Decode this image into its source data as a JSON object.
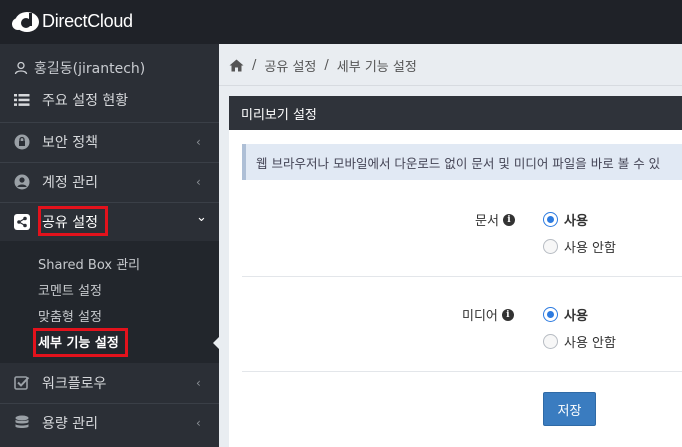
{
  "app": {
    "logo_text": "DirectCloud",
    "colors": {
      "topbar": "#1f2228",
      "sidebar": "#2b2f36",
      "accent": "#3a7cc0",
      "highlight": "#e3121c"
    }
  },
  "sidebar": {
    "user": {
      "icon": "user-icon",
      "name": "홍길동(jirantech)"
    },
    "items": [
      {
        "icon": "list-icon",
        "label": "주요 설정 현황",
        "chevron": ""
      },
      {
        "icon": "lock-icon",
        "label": "보안 정책",
        "chevron": "‹"
      },
      {
        "icon": "account-icon",
        "label": "계정 관리",
        "chevron": "‹"
      },
      {
        "icon": "share-icon",
        "label": "공유 설정",
        "chevron": "⌄"
      },
      {
        "icon": "check-square-icon",
        "label": "워크플로우",
        "chevron": "‹"
      },
      {
        "icon": "database-icon",
        "label": "용량 관리",
        "chevron": "‹"
      }
    ],
    "submenu": [
      {
        "label": "Shared Box 관리"
      },
      {
        "label": "코멘트 설정"
      },
      {
        "label": "맞춤형 설정"
      },
      {
        "label": "세부 기능 설정"
      }
    ]
  },
  "breadcrumb": {
    "home_icon": "home-icon",
    "items": [
      "공유 설정",
      "세부 기능 설정"
    ],
    "separator": "/"
  },
  "panel": {
    "title": "미리보기 설정",
    "info": "웹 브라우저나 모바일에서 다운로드 없이 문서 및 미디어 파일을 바로 볼 수 있",
    "rows": [
      {
        "label": "문서",
        "options": [
          {
            "label": "사용",
            "checked": true
          },
          {
            "label": "사용 안함",
            "checked": false
          }
        ]
      },
      {
        "label": "미디어",
        "options": [
          {
            "label": "사용",
            "checked": true
          },
          {
            "label": "사용 안함",
            "checked": false
          }
        ]
      }
    ],
    "save_label": "저장"
  }
}
